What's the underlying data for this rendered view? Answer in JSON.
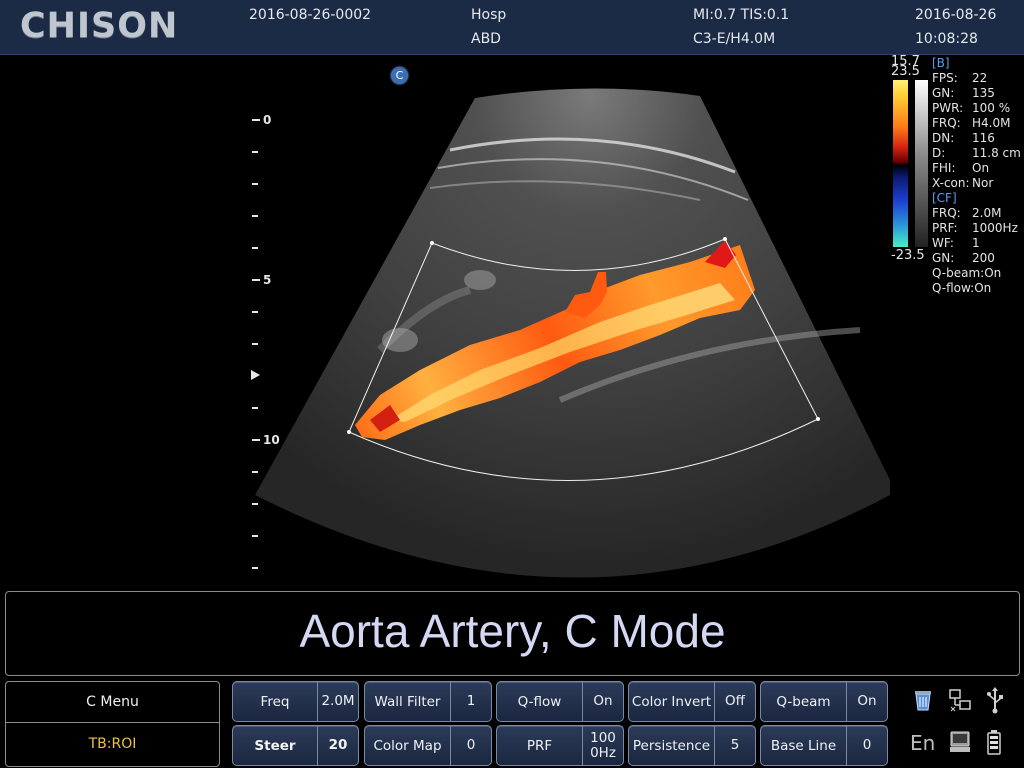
{
  "header": {
    "logo": "CHISON",
    "exam_id": "2016-08-26-0002",
    "hospital": "Hosp",
    "application": "ABD",
    "mi_tis": "MI:0.7  TIS:0.1",
    "probe": "C3-E/H4.0M",
    "date": "2016-08-26",
    "time": "10:08:28"
  },
  "image": {
    "mode_badge": "C",
    "depth_labels": [
      "0",
      "5",
      "10"
    ]
  },
  "color_scale": {
    "top_gray": "15.7",
    "top_color": "23.5",
    "bottom_color": "-23.5"
  },
  "params": {
    "b_header": "[B]",
    "b": [
      {
        "k": "FPS:",
        "v": "22"
      },
      {
        "k": "GN:",
        "v": "135"
      },
      {
        "k": "PWR:",
        "v": "100 %"
      },
      {
        "k": "FRQ:",
        "v": "H4.0M"
      },
      {
        "k": "DN:",
        "v": "116"
      },
      {
        "k": "D:",
        "v": "11.8 cm"
      },
      {
        "k": "FHI:",
        "v": "On"
      },
      {
        "k": "X-con:",
        "v": "Nor"
      }
    ],
    "cf_header": "[CF]",
    "cf": [
      {
        "k": "FRQ:",
        "v": "2.0M"
      },
      {
        "k": "PRF:",
        "v": "1000Hz"
      },
      {
        "k": "WF:",
        "v": "1"
      },
      {
        "k": "GN:",
        "v": "200"
      }
    ],
    "extra": [
      "Q-beam:On",
      "Q-flow:On"
    ]
  },
  "comment": "Aorta Artery, C Mode",
  "cmenu": {
    "title": "C Menu",
    "tb": "TB:ROI"
  },
  "controls": {
    "freq": {
      "label": "Freq",
      "value": "2.0M"
    },
    "wall_filter": {
      "label": "Wall Filter",
      "value": "1"
    },
    "q_flow": {
      "label": "Q-flow",
      "value": "On"
    },
    "color_invert": {
      "label": "Color Invert",
      "value": "Off"
    },
    "q_beam": {
      "label": "Q-beam",
      "value": "On"
    },
    "steer": {
      "label": "Steer",
      "value": "20"
    },
    "color_map": {
      "label": "Color Map",
      "value": "0"
    },
    "prf": {
      "label": "PRF",
      "value_line1": "100",
      "value_line2": "0Hz"
    },
    "persistence": {
      "label": "Persistence",
      "value": "5"
    },
    "base_line": {
      "label": "Base Line",
      "value": "0"
    }
  },
  "status": {
    "language": "En",
    "icons": [
      "recycle-bin-icon",
      "network-icon",
      "usb-icon",
      "printer-icon",
      "battery-icon"
    ]
  },
  "colors": {
    "header_bg": "#1b2a45",
    "button_bg": "#22304c",
    "accent_yellow": "#f0c040",
    "param_section_blue": "#5b9bf0"
  }
}
